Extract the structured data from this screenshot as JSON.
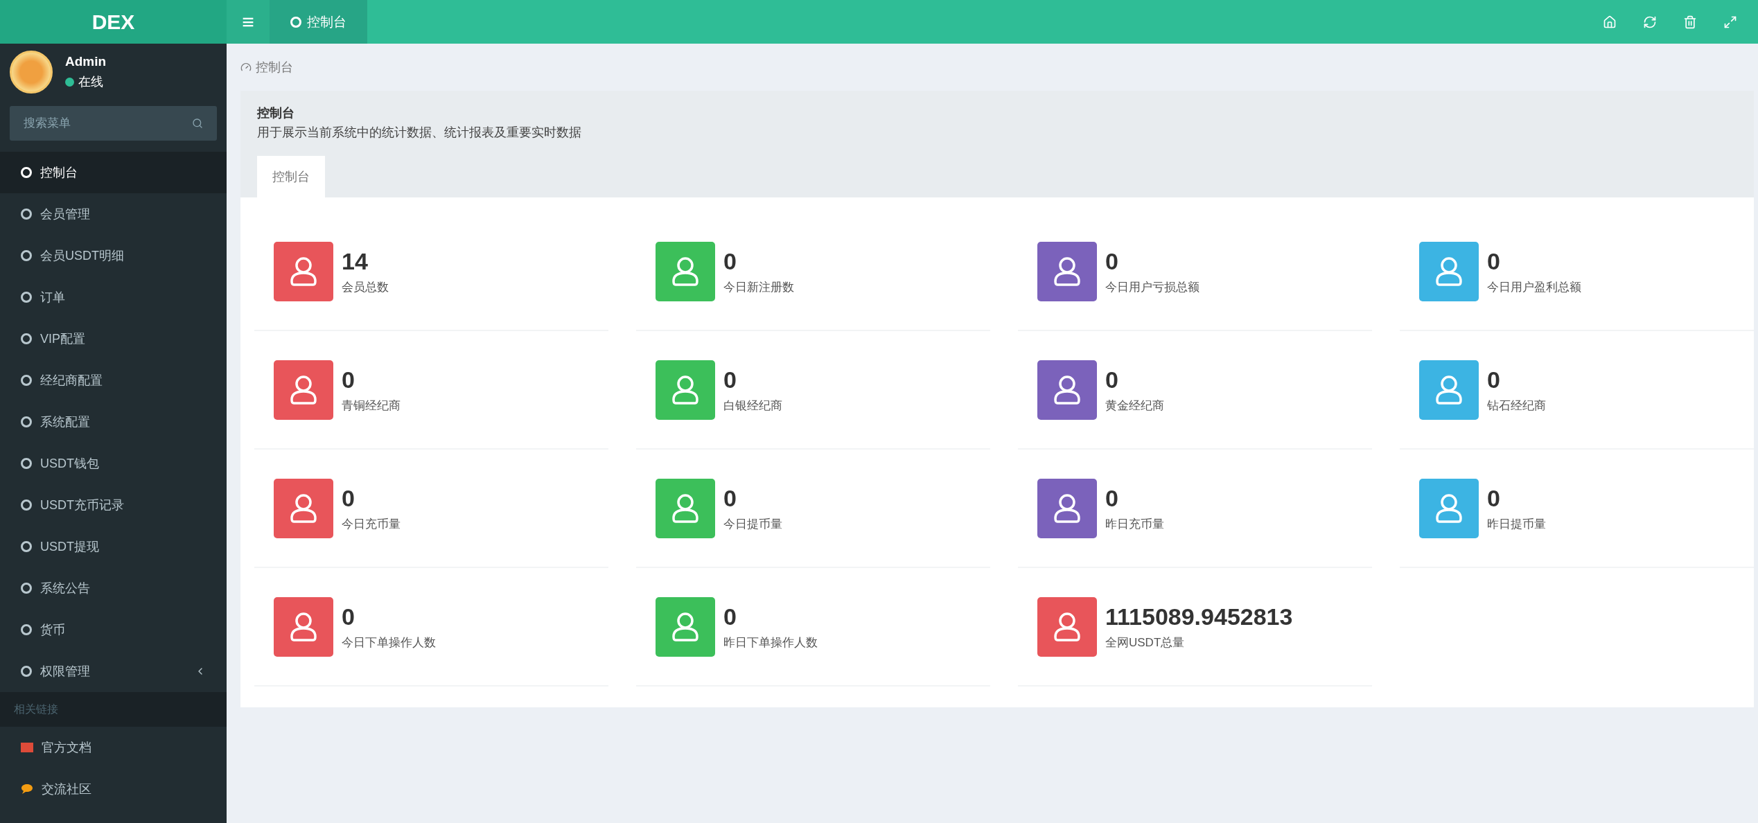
{
  "header": {
    "logo": "DEX",
    "menu_toggle": "≡",
    "tabs": [
      {
        "label": "控制台",
        "selected": true
      }
    ]
  },
  "user": {
    "name": "Admin",
    "status": "在线",
    "online": true
  },
  "search": {
    "placeholder": "搜索菜单"
  },
  "menu": [
    {
      "label": "控制台",
      "selected": true,
      "submenu": false
    },
    {
      "label": "会员管理",
      "selected": false,
      "submenu": false
    },
    {
      "label": "会员USDT明细",
      "selected": false,
      "submenu": false
    },
    {
      "label": "订单",
      "selected": false,
      "submenu": false
    },
    {
      "label": "VIP配置",
      "selected": false,
      "submenu": false
    },
    {
      "label": "经纪商配置",
      "selected": false,
      "submenu": false
    },
    {
      "label": "系统配置",
      "selected": false,
      "submenu": false
    },
    {
      "label": "USDT钱包",
      "selected": false,
      "submenu": false
    },
    {
      "label": "USDT充币记录",
      "selected": false,
      "submenu": false
    },
    {
      "label": "USDT提现",
      "selected": false,
      "submenu": false
    },
    {
      "label": "系统公告",
      "selected": false,
      "submenu": false
    },
    {
      "label": "货币",
      "selected": false,
      "submenu": false
    },
    {
      "label": "权限管理",
      "selected": false,
      "submenu": true
    }
  ],
  "links_heading": "相关链接",
  "links": [
    {
      "label": "官方文档",
      "kind": "doc"
    },
    {
      "label": "交流社区",
      "kind": "chat"
    }
  ],
  "breadcrumb": "控制台",
  "panel": {
    "title": "控制台",
    "description": "用于展示当前系统中的统计数据、统计报表及重要实时数据",
    "tabs": [
      {
        "label": "控制台",
        "selected": true
      }
    ]
  },
  "stats": [
    {
      "value": "14",
      "label": "会员总数",
      "color": "#e8555a"
    },
    {
      "value": "0",
      "label": "今日新注册数",
      "color": "#3cbf5a"
    },
    {
      "value": "0",
      "label": "今日用户亏损总额",
      "color": "#7b62bb"
    },
    {
      "value": "0",
      "label": "今日用户盈利总额",
      "color": "#3cb4e3"
    },
    {
      "value": "0",
      "label": "青铜经纪商",
      "color": "#e8555a"
    },
    {
      "value": "0",
      "label": "白银经纪商",
      "color": "#3cbf5a"
    },
    {
      "value": "0",
      "label": "黄金经纪商",
      "color": "#7b62bb"
    },
    {
      "value": "0",
      "label": "钻石经纪商",
      "color": "#3cb4e3"
    },
    {
      "value": "0",
      "label": "今日充币量",
      "color": "#e8555a"
    },
    {
      "value": "0",
      "label": "今日提币量",
      "color": "#3cbf5a"
    },
    {
      "value": "0",
      "label": "昨日充币量",
      "color": "#7b62bb"
    },
    {
      "value": "0",
      "label": "昨日提币量",
      "color": "#3cb4e3"
    },
    {
      "value": "0",
      "label": "今日下单操作人数",
      "color": "#e8555a"
    },
    {
      "value": "0",
      "label": "昨日下单操作人数",
      "color": "#3cbf5a"
    },
    {
      "value": "1115089.9452813",
      "label": "全网USDT总量",
      "color": "#e8555a"
    }
  ]
}
